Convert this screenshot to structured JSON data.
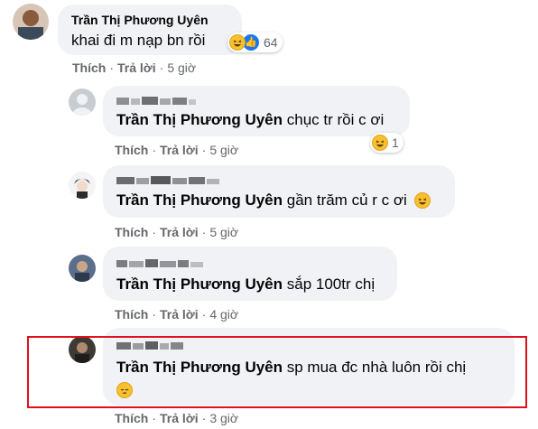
{
  "comments": [
    {
      "author": "Trần Thị Phương Uyên",
      "text": "khai đi m nạp bn rồi",
      "reactions": "64",
      "actions": {
        "like": "Thích",
        "reply": "Trả lời",
        "time": "5 giờ"
      }
    }
  ],
  "replies": [
    {
      "tag": "Trần Thị Phương Uyên",
      "text": " chục tr rồi c ơi",
      "reactions": "1",
      "actions": {
        "like": "Thích",
        "reply": "Trả lời",
        "time": "5 giờ"
      }
    },
    {
      "tag": "Trần Thị Phương Uyên",
      "text": " gần trăm củ r c ơi",
      "actions": {
        "like": "Thích",
        "reply": "Trả lời",
        "time": "5 giờ"
      }
    },
    {
      "tag": "Trần Thị Phương Uyên",
      "text": " sắp 100tr chị",
      "actions": {
        "like": "Thích",
        "reply": "Trả lời",
        "time": "4 giờ"
      }
    },
    {
      "tag": "Trần Thị Phương Uyên",
      "text": " sp mua đc nhà luôn rồi chị",
      "actions": {
        "like": "Thích",
        "reply": "Trả lời",
        "time": "3 giờ"
      }
    }
  ],
  "separator": "·",
  "colors": {
    "bubble": "#f0f2f5",
    "highlight": "#e0101a",
    "meta": "#65676b",
    "like_blue": "#1877f2"
  },
  "icons": {
    "haha": "laughing-emoji-icon",
    "like": "thumbs-up-icon",
    "pensive": "pensive-emoji-icon"
  }
}
